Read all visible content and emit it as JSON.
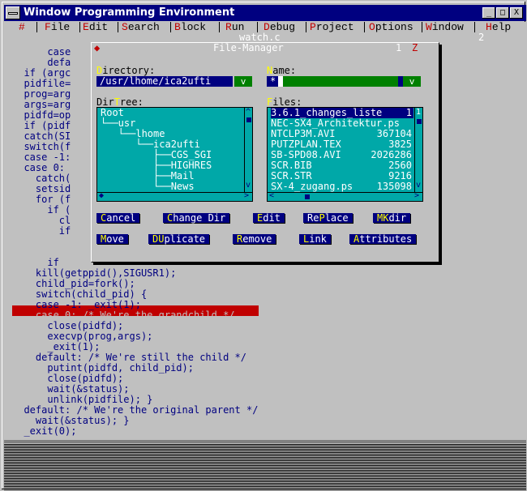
{
  "window": {
    "title": "Window Programming Environment"
  },
  "titlebar_buttons": {
    "minimize": "_",
    "maximize": "□",
    "close": "X"
  },
  "menu": {
    "items": [
      {
        "hk": "#",
        "rest": ""
      },
      {
        "hk": "F",
        "rest": "ile"
      },
      {
        "hk": "E",
        "rest": "dit"
      },
      {
        "hk": "S",
        "rest": "earch"
      },
      {
        "hk": "B",
        "rest": "lock"
      },
      {
        "hk": "R",
        "rest": "un"
      },
      {
        "hk": "D",
        "rest": "ebug"
      },
      {
        "hk": "P",
        "rest": "roject"
      },
      {
        "hk": "O",
        "rest": "ptions"
      },
      {
        "hk": "W",
        "rest": "indow"
      },
      {
        "hk": "H",
        "rest": "elp"
      }
    ]
  },
  "editor": {
    "filename": "watch.c",
    "window_number": "2",
    "lines": [
      "      case",
      "      defa",
      "  if (argc",
      "  pidfile=",
      "  prog=arg",
      "  args=arg",
      "  pidfd=op",
      "  if (pidf",
      "  catch(SI",
      "  switch(f",
      "  case -1:",
      "  case 0:",
      "    catch(",
      "    setsid",
      "    for (f",
      "      if (",
      "        cl",
      "        if",
      "",
      "",
      "      if",
      "    kill(getppid(),SIGUSR1);",
      "    child_pid=fork();",
      "    switch(child_pid) {",
      "    case -1: _exit(1);",
      "    case 0: /* We're the grandchild */",
      "      close(pidfd);",
      "      execvp(prog,args);",
      "      _exit(1);",
      "    default: /* We're still the child */",
      "      putint(pidfd, child_pid);",
      "      close(pidfd);",
      "      wait(&status);",
      "      unlink(pidfile); }",
      "  default: /* We're the original parent */",
      "    wait(&status); }",
      "  _exit(0);"
    ]
  },
  "file_manager": {
    "title": "File-Manager",
    "close_glyph": "◆",
    "number": "1",
    "zoom": "Z",
    "directory": {
      "label_hk": "D",
      "label_rest": "irectory:",
      "value": "/usr/lhome/ica2ufti",
      "dropdown": "v"
    },
    "name": {
      "label_hk": "N",
      "label_rest": "ame:",
      "value": "*",
      "dropdown": "v"
    },
    "dirtree": {
      "label_pre": "Dir",
      "label_hk": "T",
      "label_rest": "ree:",
      "items": [
        "Root",
        "└──usr",
        "   └──lhome",
        "      └──ica2ufti",
        "         ├──CGS_SGI",
        "         ├──HIGHRES",
        "         ├──Mail",
        "         └──News"
      ],
      "scroll_top": "^",
      "scroll_bottom": "v",
      "scroll_left": "◆",
      "scroll_right": ">"
    },
    "files": {
      "label_hk": "F",
      "label_rest": "iles:",
      "items": [
        {
          "name": "3.6.1_changes_liste",
          "size": "1"
        },
        {
          "name": "NEC-SX4_Architektur.ps",
          "size": ""
        },
        {
          "name": "NTCLP3M.AVI",
          "size": "367104"
        },
        {
          "name": "PUTZPLAN.TEX",
          "size": "3825"
        },
        {
          "name": "SB-SPD08.AVI",
          "size": "2026286"
        },
        {
          "name": "SCR.BIB",
          "size": "2560"
        },
        {
          "name": "SCR.STR",
          "size": "9216"
        },
        {
          "name": "SX-4_zugang.ps",
          "size": "135098"
        }
      ],
      "scroll_top": "1",
      "scroll_bottom": "v",
      "scroll_left": "<",
      "scroll_right": ">"
    },
    "buttons_row1": [
      {
        "hk": "C",
        "rest": "ancel",
        "pre": ""
      },
      {
        "hk": "C",
        "rest": "hange Dir",
        "pre": ""
      },
      {
        "hk": "E",
        "rest": "dit",
        "pre": ""
      },
      {
        "hk": "P",
        "rest": "lace",
        "pre": "Re"
      },
      {
        "hk": "MK",
        "rest": "dir",
        "pre": ""
      }
    ],
    "buttons_row2": [
      {
        "hk": "M",
        "rest": "ove",
        "pre": ""
      },
      {
        "hk": "DU",
        "rest": "plicate",
        "pre": ""
      },
      {
        "hk": "R",
        "rest": "emove",
        "pre": ""
      },
      {
        "hk": "L",
        "rest": "ink",
        "pre": ""
      },
      {
        "hk": "A",
        "rest": "ttributes",
        "pre": ""
      }
    ]
  },
  "colors": {
    "titlebar": "#000080",
    "hotkey_menu": "#c00000",
    "hotkey_dialog": "#ffff00",
    "highlight_line": "#c00000",
    "list_bg": "#00a8a8"
  }
}
